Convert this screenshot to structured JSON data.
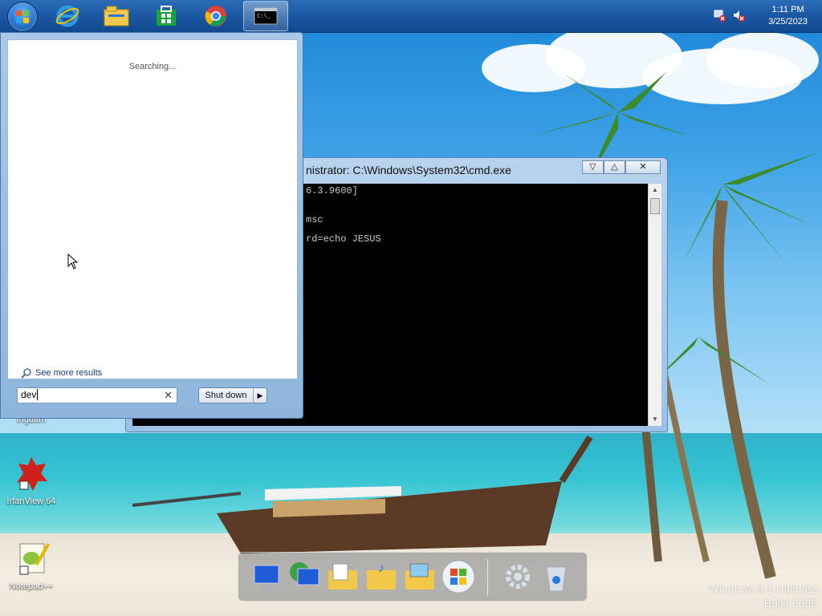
{
  "taskbar": {
    "pinned": [
      {
        "name": "start-orb"
      },
      {
        "name": "internet-explorer-icon"
      },
      {
        "name": "file-explorer-icon"
      },
      {
        "name": "windows-store-icon"
      },
      {
        "name": "chrome-icon"
      },
      {
        "name": "command-prompt-icon",
        "active": true
      }
    ],
    "clock": {
      "time": "1:11 PM",
      "date": "3/25/2023"
    }
  },
  "start_menu": {
    "status_text": "Searching...",
    "see_more": "See more results",
    "search_value": "dev",
    "shutdown_label": "Shut down"
  },
  "cmd_window": {
    "title": "nistrator: C:\\Windows\\System32\\cmd.exe",
    "lines": [
      "6.3.9600]",
      "",
      "msc",
      "",
      "rd=echo JESUS"
    ]
  },
  "desktop_icons": [
    {
      "label": "Ingdum"
    },
    {
      "label": "IrfanView 64"
    },
    {
      "label": "Notepad++"
    }
  ],
  "dock_items": [
    "computer-icon",
    "network-icon",
    "documents-folder-icon",
    "music-folder-icon",
    "pictures-folder-icon",
    "windows-logo-icon",
    "settings-gear-icon",
    "recycle-bin-icon"
  ],
  "watermark": {
    "line1": "Windows 8.1 Ultimate",
    "line2": "Build 9600"
  },
  "colors": {
    "taskbar": "#1b59a3",
    "start_menu_frame": "#8eb6dc",
    "cmd_background": "#000000"
  }
}
